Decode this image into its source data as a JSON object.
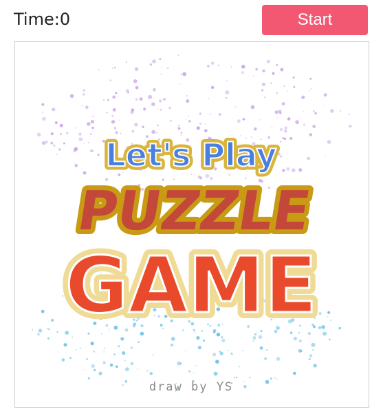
{
  "timer": {
    "label": "Time:",
    "value": "0"
  },
  "controls": {
    "start_label": "Start"
  },
  "puzzle_image": {
    "line1": "Let's Play",
    "line2": "PUZZLE",
    "line3": "GAME",
    "credit": "draw by YS"
  },
  "colors": {
    "start_button": "#f35872",
    "title_line1": "#4a7fe0",
    "title_line2": "#c3483a",
    "title_line3": "#ea4a2c",
    "outline_gold": "#d9b53b",
    "splatter_top": "#c9a6e8",
    "splatter_bottom": "#6ec1e4",
    "credit_text": "#8a8a8a"
  },
  "icons": [
    "paint-splatter-decoration"
  ]
}
